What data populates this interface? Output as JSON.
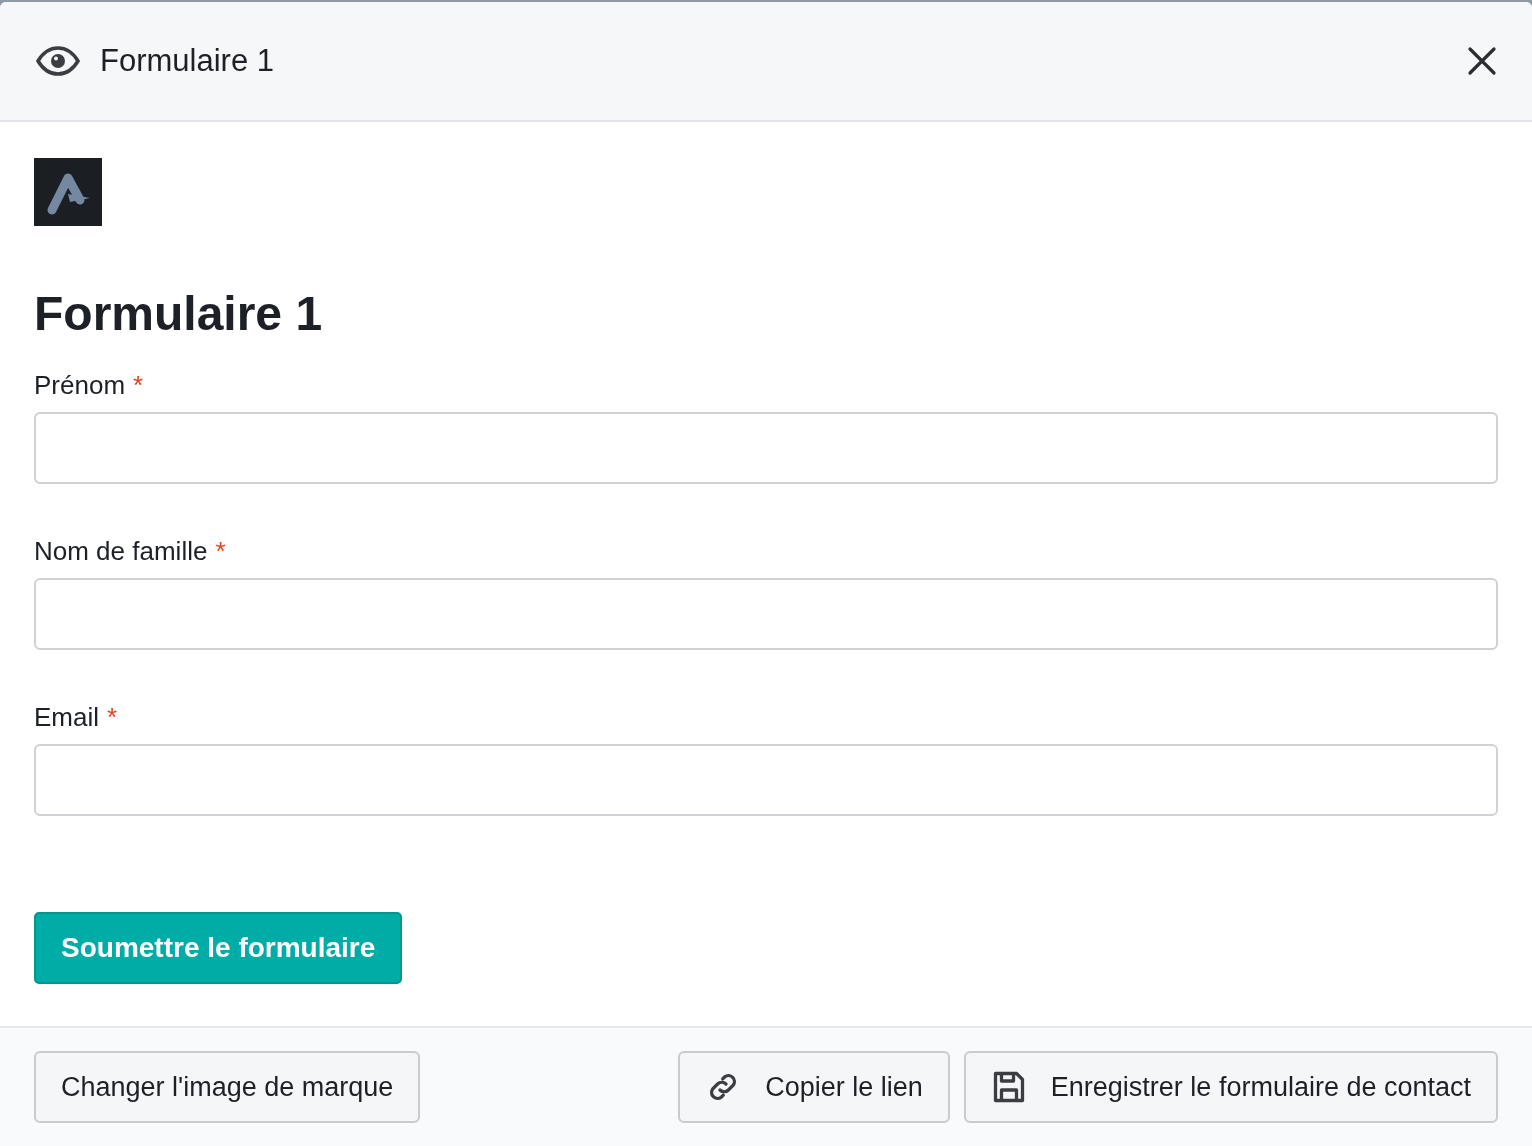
{
  "dialog": {
    "title": "Formulaire 1"
  },
  "form": {
    "heading": "Formulaire 1",
    "fields": [
      {
        "label": "Prénom",
        "required_mark": "*"
      },
      {
        "label": "Nom de famille",
        "required_mark": "*"
      },
      {
        "label": "Email",
        "required_mark": "*"
      }
    ],
    "submit": "Soumettre le formulaire"
  },
  "footer": {
    "left_button": "Changer l'image de marque",
    "right_buttons": [
      {
        "kind": "link",
        "label": "Copier le lien"
      },
      {
        "kind": "save",
        "label": "Enregistrer le formulaire de contact"
      }
    ]
  }
}
